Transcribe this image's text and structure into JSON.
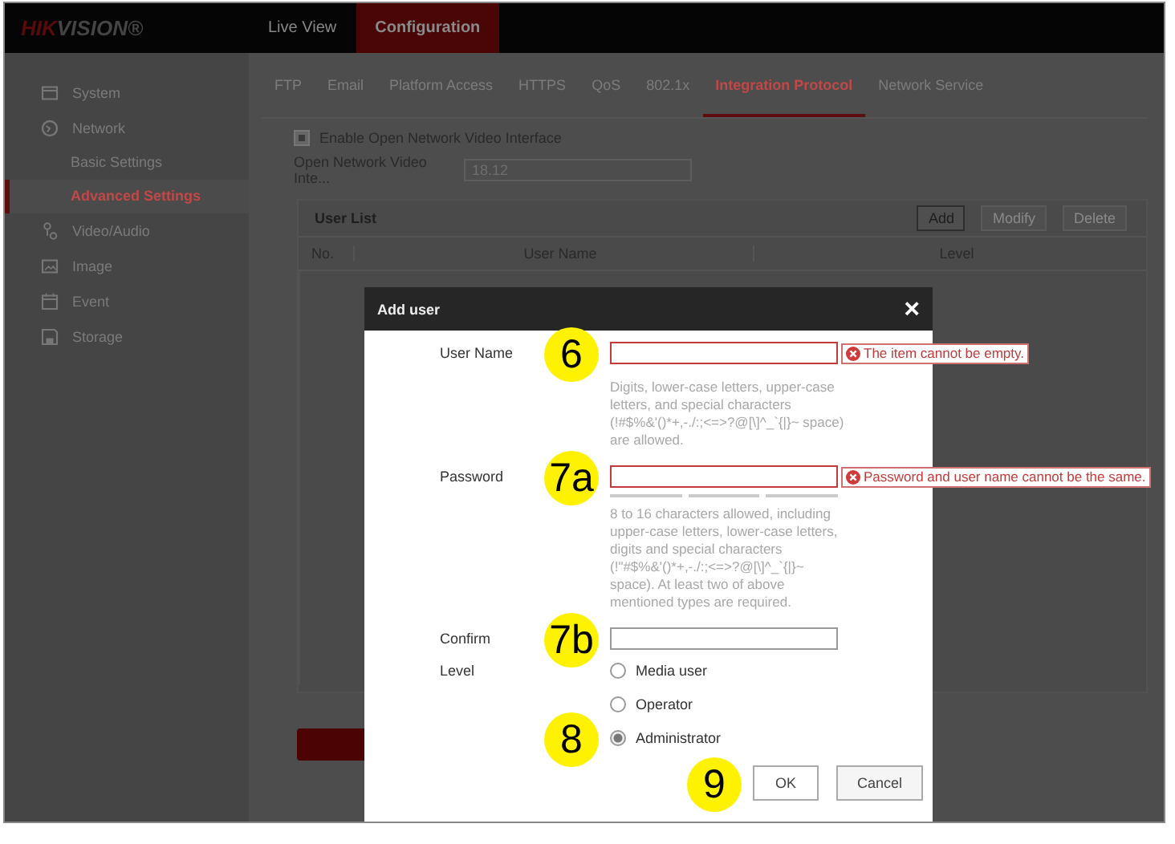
{
  "logo": [
    {
      "text": "HIK",
      "kind": "accent"
    },
    {
      "text": "VISION®",
      "kind": "plain"
    }
  ],
  "nav": [
    {
      "label": "Live View",
      "selected": false
    },
    {
      "label": "Configuration",
      "selected": true
    }
  ],
  "sidebar": {
    "items": [
      {
        "label": "System"
      },
      {
        "label": "Network",
        "children": [
          {
            "label": "Basic Settings",
            "selected": false
          },
          {
            "label": "Advanced Settings",
            "selected": true
          }
        ]
      },
      {
        "label": "Video/Audio"
      },
      {
        "label": "Image"
      },
      {
        "label": "Event"
      },
      {
        "label": "Storage"
      }
    ]
  },
  "tabs": [
    {
      "label": "FTP",
      "selected": false
    },
    {
      "label": "Email",
      "selected": false
    },
    {
      "label": "Platform Access",
      "selected": false
    },
    {
      "label": "HTTPS",
      "selected": false
    },
    {
      "label": "QoS",
      "selected": false
    },
    {
      "label": "802.1x",
      "selected": false
    },
    {
      "label": "Integration Protocol",
      "selected": true
    },
    {
      "label": "Network Service",
      "selected": false
    }
  ],
  "enable_checkbox": {
    "label": "Enable Open Network Video Interface",
    "checked": true
  },
  "version_field": {
    "label": "Open Network Video Inte...",
    "value": "18.12"
  },
  "user_list": {
    "title": "User List",
    "buttons": [
      {
        "label": "Add",
        "disabled": false
      },
      {
        "label": "Modify",
        "disabled": true
      },
      {
        "label": "Delete",
        "disabled": true
      }
    ],
    "columns": [
      "No.",
      "User Name",
      "Level"
    ]
  },
  "dialog": {
    "title": "Add user",
    "close": "×",
    "fields": [
      {
        "label": "User Name",
        "kind": "text",
        "error": "The item cannot be empty.",
        "hint": "Digits, lower-case letters, upper-case letters, and special characters (!#$%&'()*+,-./:;<=>?@[\\]^_`{|}~ space) are allowed."
      },
      {
        "label": "Password",
        "kind": "password",
        "error": "Password and user name cannot be the same.",
        "hint": "8 to 16 characters allowed, including upper-case letters, lower-case letters, digits and special characters (!\"#$%&'()*+,-./:;<=>?@[\\]^_`{|}~ space). At least two of above mentioned types are required."
      },
      {
        "label": "Confirm",
        "kind": "confirm"
      }
    ],
    "level_label": "Level",
    "levels": [
      {
        "label": "Media user",
        "selected": false
      },
      {
        "label": "Operator",
        "selected": false
      },
      {
        "label": "Administrator",
        "selected": true
      }
    ],
    "buttons": [
      "OK",
      "Cancel"
    ]
  },
  "annotations": [
    "6",
    "7a",
    "7b",
    "8",
    "9"
  ]
}
